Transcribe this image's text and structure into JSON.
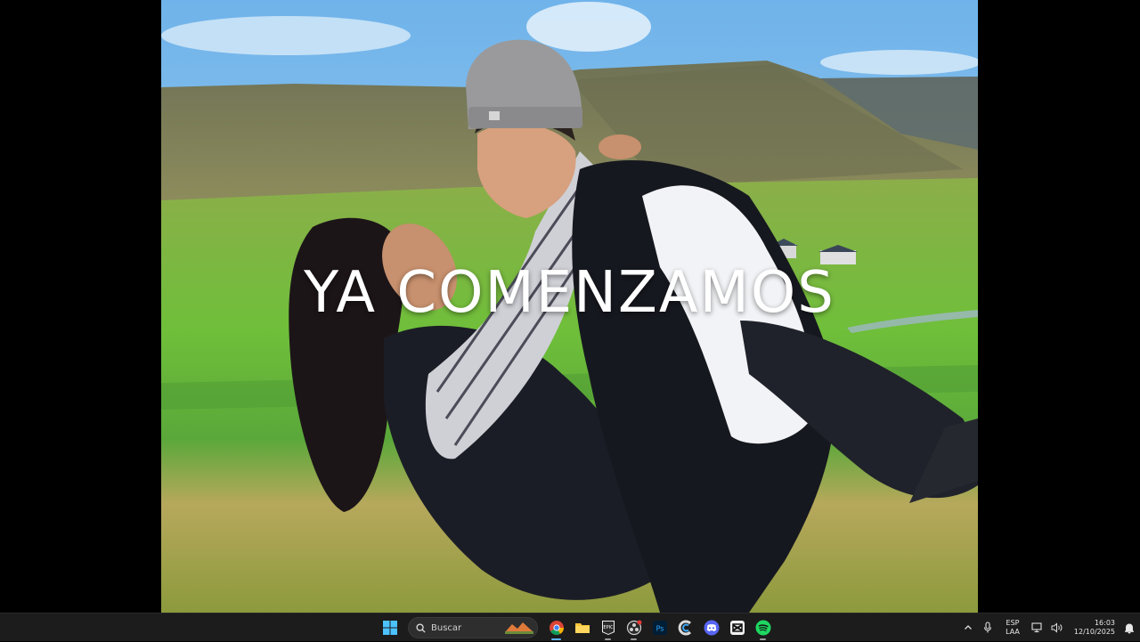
{
  "slide": {
    "title": "YA COMENZAMOS"
  },
  "taskbar": {
    "search_placeholder": "Buscar",
    "apps": [
      {
        "name": "start-icon"
      },
      {
        "name": "chrome-icon",
        "active": true
      },
      {
        "name": "file-explorer-icon"
      },
      {
        "name": "epic-games-icon"
      },
      {
        "name": "obs-icon"
      },
      {
        "name": "photoshop-icon"
      },
      {
        "name": "ccleaner-icon"
      },
      {
        "name": "discord-icon"
      },
      {
        "name": "capcut-icon"
      },
      {
        "name": "spotify-icon"
      }
    ],
    "tray": {
      "language_line1": "ESP",
      "language_line2": "LAA",
      "time": "16:03",
      "date": "12/10/2025"
    },
    "colors": {
      "accent": "#5eb3ff",
      "background": "#1c1c1c"
    }
  }
}
